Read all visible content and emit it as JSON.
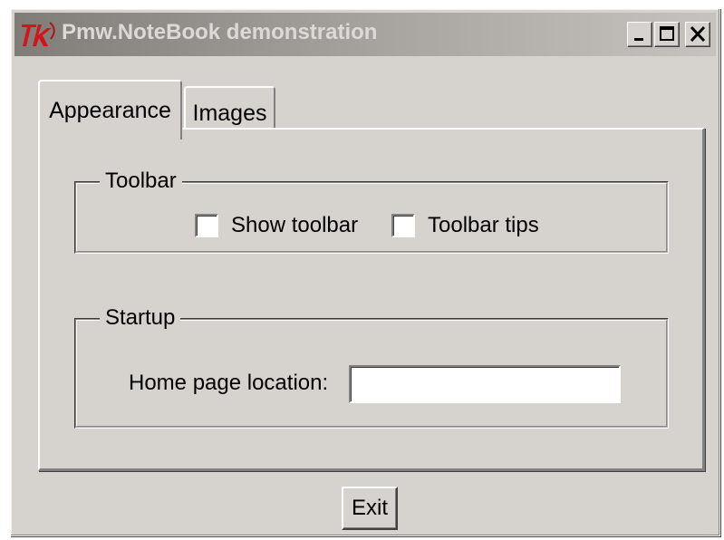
{
  "window": {
    "title": "Pmw.NoteBook demonstration",
    "icon": "tk-feather-icon",
    "controls": {
      "minimize_icon": "minimize-icon",
      "maximize_icon": "maximize-icon",
      "close_icon": "close-icon"
    }
  },
  "tabs": [
    {
      "label": "Appearance",
      "selected": true
    },
    {
      "label": "Images",
      "selected": false
    }
  ],
  "toolbar_group": {
    "legend": "Toolbar",
    "checkboxes": [
      {
        "label": "Show toolbar",
        "checked": false
      },
      {
        "label": "Toolbar tips",
        "checked": false
      }
    ]
  },
  "startup_group": {
    "legend": "Startup",
    "home_page_label": "Home page location:",
    "home_page_value": ""
  },
  "buttons": {
    "exit_label": "Exit"
  },
  "colors": {
    "face": "#d6d3ce",
    "titlebar_start": "#807d79",
    "titlebar_end": "#c6c3bf",
    "icon_red": "#d4141c"
  }
}
